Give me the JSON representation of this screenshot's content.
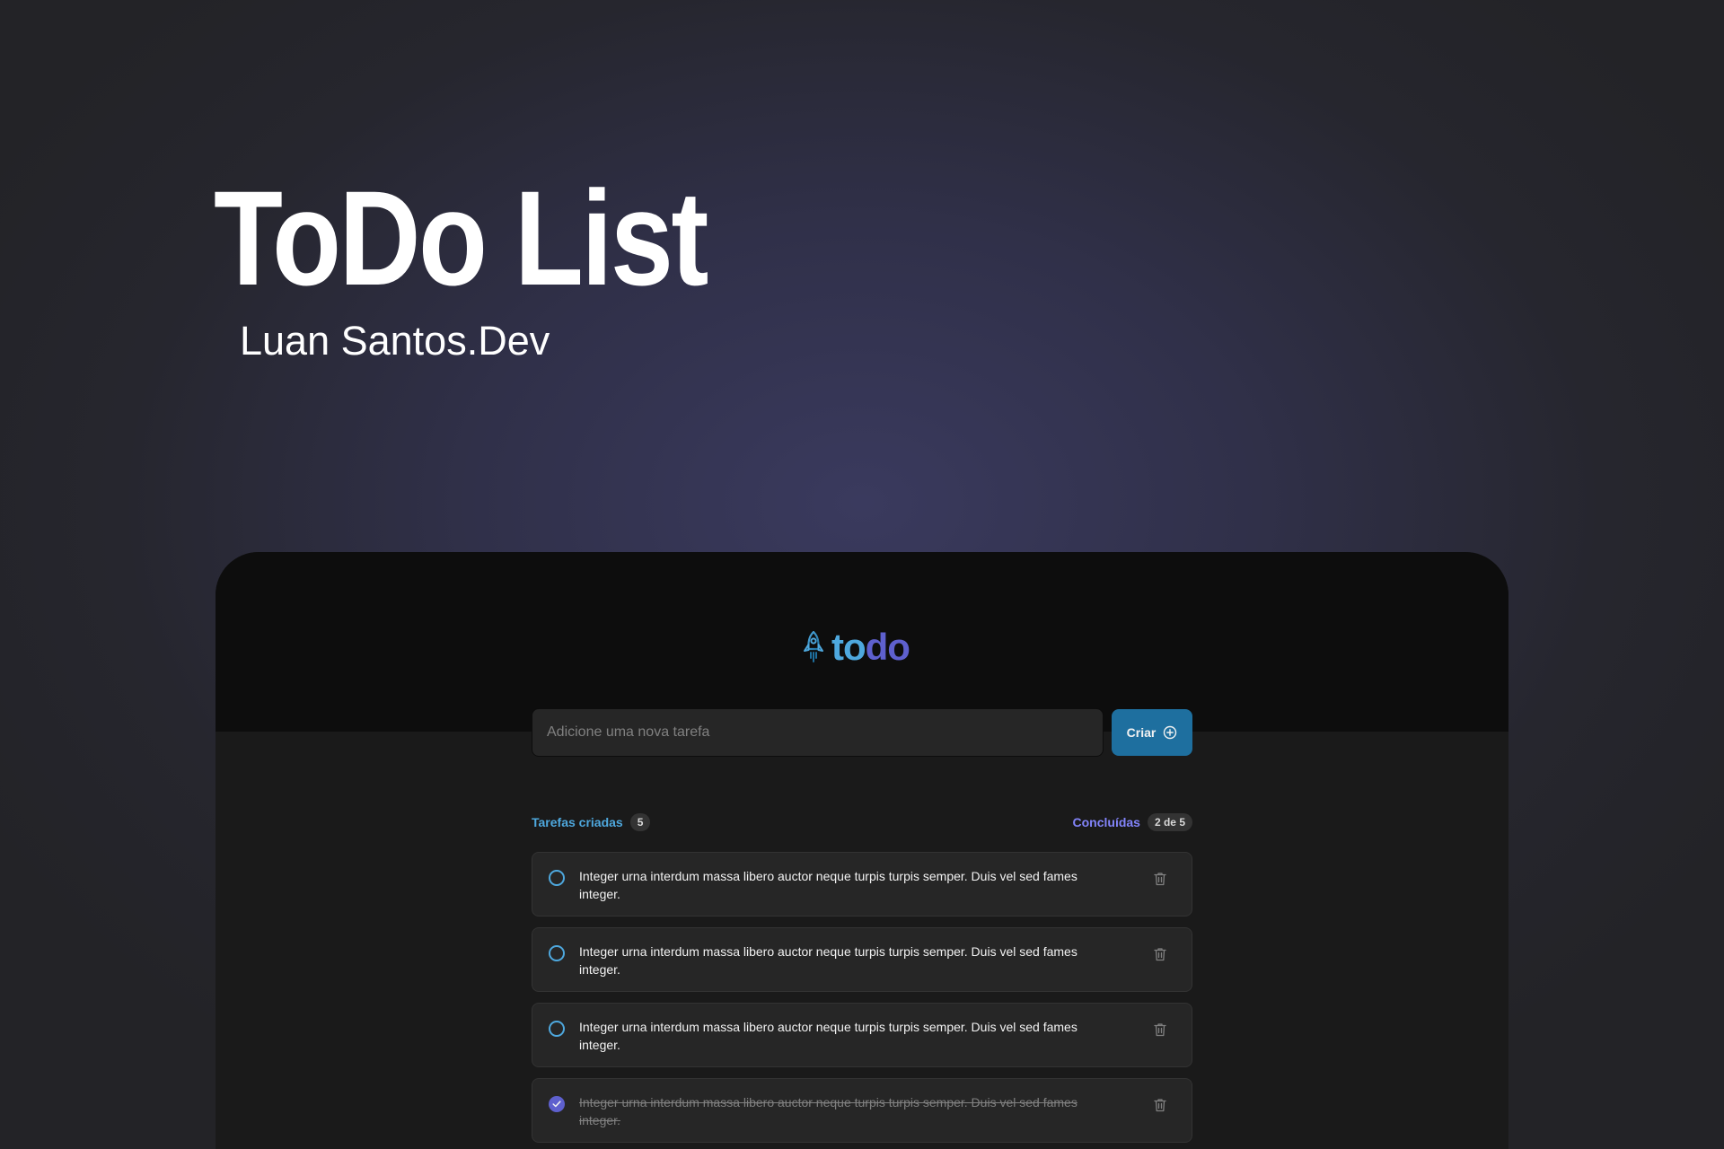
{
  "hero": {
    "title": "ToDo List",
    "subtitle": "Luan Santos.Dev"
  },
  "app": {
    "logo": {
      "icon": "rocket-icon",
      "text_part1": "to",
      "text_part2": "do"
    },
    "form": {
      "placeholder": "Adicione uma nova tarefa",
      "value": "",
      "create_label": "Criar",
      "create_icon": "plus-circle-icon"
    },
    "counters": {
      "created_label": "Tarefas criadas",
      "created_count": "5",
      "done_label": "Concluídas",
      "done_count": "2 de 5"
    },
    "tasks": [
      {
        "text": "Integer urna interdum massa libero auctor neque turpis turpis semper. Duis vel sed fames integer.",
        "completed": false
      },
      {
        "text": "Integer urna interdum massa libero auctor neque turpis turpis semper. Duis vel sed fames integer.",
        "completed": false
      },
      {
        "text": "Integer urna interdum massa libero auctor neque turpis turpis semper. Duis vel sed fames integer.",
        "completed": false
      },
      {
        "text": "Integer urna interdum massa libero auctor neque turpis turpis semper. Duis vel sed fames integer.",
        "completed": true
      }
    ]
  },
  "colors": {
    "blue": "#4ea8de",
    "blue_dark": "#1e6f9f",
    "purple": "#5e60ce",
    "purple_light": "#8284fa"
  }
}
